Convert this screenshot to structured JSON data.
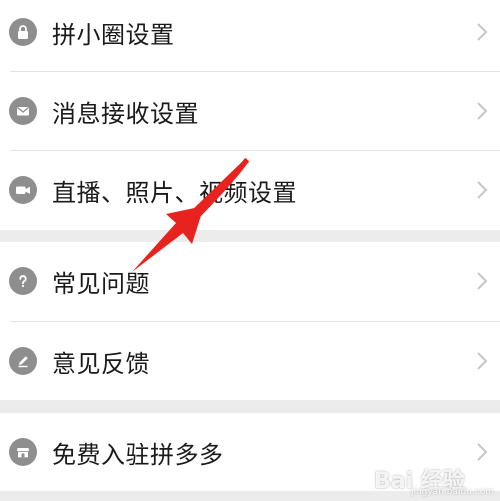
{
  "menu": {
    "items": [
      {
        "label": "拼小圈设置",
        "icon": "lock-icon"
      },
      {
        "label": "消息接收设置",
        "icon": "mail-icon"
      },
      {
        "label": "直播、照片、视频设置",
        "icon": "video-camera-icon"
      },
      {
        "label": "常见问题",
        "icon": "question-icon"
      },
      {
        "label": "意见反馈",
        "icon": "pencil-icon"
      },
      {
        "label": "免费入驻拼多多",
        "icon": "store-icon"
      }
    ]
  },
  "colors": {
    "background": "#ececec",
    "row": "#ffffff",
    "icon": "#8e8e8e",
    "text": "#1a1a1a",
    "chevron": "#c7c7c7",
    "annotation_arrow": "#e8231f"
  },
  "watermark": {
    "text": "Bai 经验",
    "sub": "jingyan.baidu.com"
  }
}
